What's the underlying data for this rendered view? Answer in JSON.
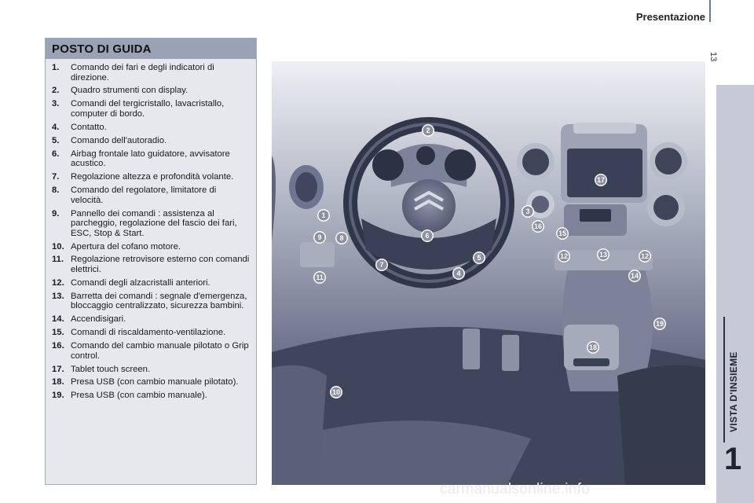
{
  "header": {
    "title": "Presentazione",
    "page_number": "13"
  },
  "side_tab": {
    "chapter_label": "VISTA D'INSIEME",
    "chapter_number": "1"
  },
  "panel": {
    "title": "POSTO DI GUIDA",
    "items": [
      {
        "num": "1.",
        "text": "Comando dei fari e degli indicatori di direzione."
      },
      {
        "num": "2.",
        "text": "Quadro strumenti con display."
      },
      {
        "num": "3.",
        "text": "Comandi del tergicristallo, lavacristallo, computer di bordo."
      },
      {
        "num": "4.",
        "text": "Contatto."
      },
      {
        "num": "5.",
        "text": "Comando dell'autoradio."
      },
      {
        "num": "6.",
        "text": "Airbag frontale lato guidatore, avvisatore acustico."
      },
      {
        "num": "7.",
        "text": "Regolazione altezza e profondità volante."
      },
      {
        "num": "8.",
        "text": "Comando del regolatore, limitatore di velocità."
      },
      {
        "num": "9.",
        "text": "Pannello dei comandi : assistenza al parcheggio, regolazione del fascio dei fari, ESC, Stop & Start."
      },
      {
        "num": "10.",
        "text": "Apertura del cofano motore."
      },
      {
        "num": "11.",
        "text": "Regolazione retrovisore esterno con comandi elettrici."
      },
      {
        "num": "12.",
        "text": "Comandi degli alzacristalli anteriori."
      },
      {
        "num": "13.",
        "text": "Barretta dei comandi : segnale d'emergenza, bloccaggio centralizzato, sicurezza bambini."
      },
      {
        "num": "14.",
        "text": "Accendisigari."
      },
      {
        "num": "15.",
        "text": "Comandi di riscaldamento-ventilazione."
      },
      {
        "num": "16.",
        "text": "Comando del cambio manuale pilotato o Grip control."
      },
      {
        "num": "17.",
        "text": "Tablet touch screen."
      },
      {
        "num": "18.",
        "text": "Presa USB (con cambio manuale pilotato)."
      },
      {
        "num": "19.",
        "text": "Presa USB (con cambio manuale)."
      }
    ]
  },
  "illustration": {
    "callouts": [
      "1",
      "2",
      "3",
      "4",
      "5",
      "6",
      "7",
      "8",
      "9",
      "10",
      "11",
      "12",
      "13",
      "12",
      "14",
      "15",
      "16",
      "17",
      "18",
      "19"
    ]
  },
  "watermark": {
    "text": "carmanualsonline.info"
  },
  "colors": {
    "panel_header": "#9aa2b6",
    "panel_bg": "#e6e8ed",
    "side_tab": "#c6cad6",
    "dashboard": "#4a5068"
  }
}
